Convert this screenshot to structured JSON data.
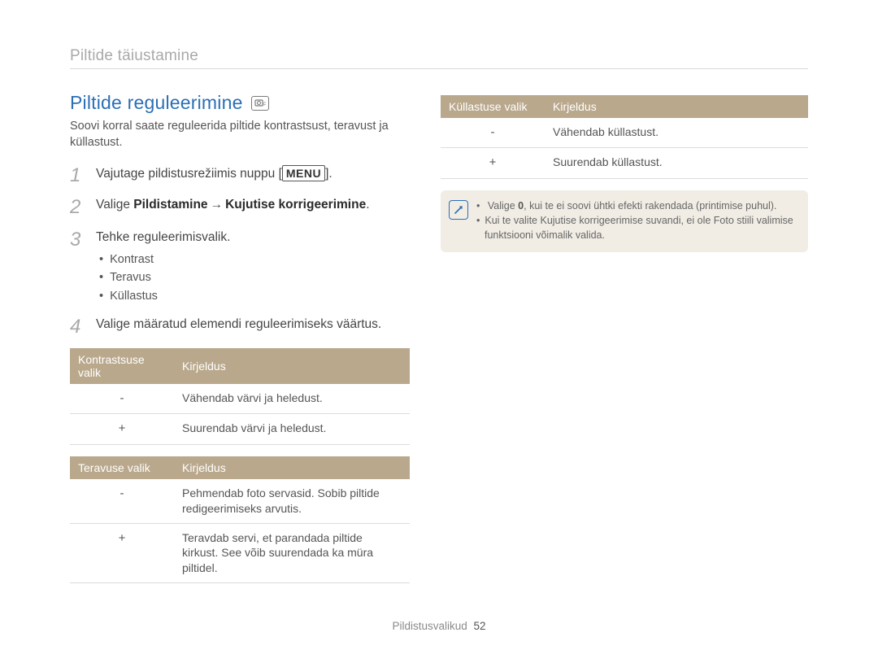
{
  "header": {
    "title": "Piltide täiustamine"
  },
  "section": {
    "title": "Piltide reguleerimine",
    "mode_icon": "camera-p-icon",
    "intro": "Soovi korral saate reguleerida piltide kontrastsust, teravust ja küllastust."
  },
  "steps": [
    {
      "n": "1",
      "pre": "Vajutage pildistusrežiimis nuppu [",
      "btn": "MENU",
      "post": "]."
    },
    {
      "n": "2",
      "pre": "Valige ",
      "bold1": "Pildistamine",
      "arrow": "→",
      "bold2": "Kujutise korrigeerimine",
      "post": "."
    },
    {
      "n": "3",
      "text": "Tehke reguleerimisvalik.",
      "items": [
        "Kontrast",
        "Teravus",
        "Küllastus"
      ]
    },
    {
      "n": "4",
      "text": "Valige määratud elemendi reguleerimiseks väärtus."
    }
  ],
  "tables": {
    "contrast": {
      "headers": [
        "Kontrastsuse valik",
        "Kirjeldus"
      ],
      "rows": [
        {
          "sym": "-",
          "desc": "Vähendab värvi ja heledust."
        },
        {
          "sym": "+",
          "desc": "Suurendab värvi ja heledust."
        }
      ]
    },
    "sharpness": {
      "headers": [
        "Teravuse valik",
        "Kirjeldus"
      ],
      "rows": [
        {
          "sym": "-",
          "desc": "Pehmendab foto servasid. Sobib piltide redigeerimiseks arvutis."
        },
        {
          "sym": "+",
          "desc": "Teravdab servi, et parandada piltide kirkust. See võib suurendada ka müra piltidel."
        }
      ]
    },
    "saturation": {
      "headers": [
        "Küllastuse valik",
        "Kirjeldus"
      ],
      "rows": [
        {
          "sym": "-",
          "desc": "Vähendab küllastust."
        },
        {
          "sym": "+",
          "desc": "Suurendab küllastust."
        }
      ]
    }
  },
  "note": {
    "items": [
      {
        "pre": "Valige ",
        "bold": "0",
        "post": ", kui te ei soovi ühtki efekti rakendada (printimise puhul)."
      },
      {
        "text": "Kui te valite Kujutise korrigeerimise suvandi, ei ole Foto stiili valimise funktsiooni võimalik valida."
      }
    ]
  },
  "footer": {
    "label": "Pildistusvalikud",
    "page": "52"
  }
}
